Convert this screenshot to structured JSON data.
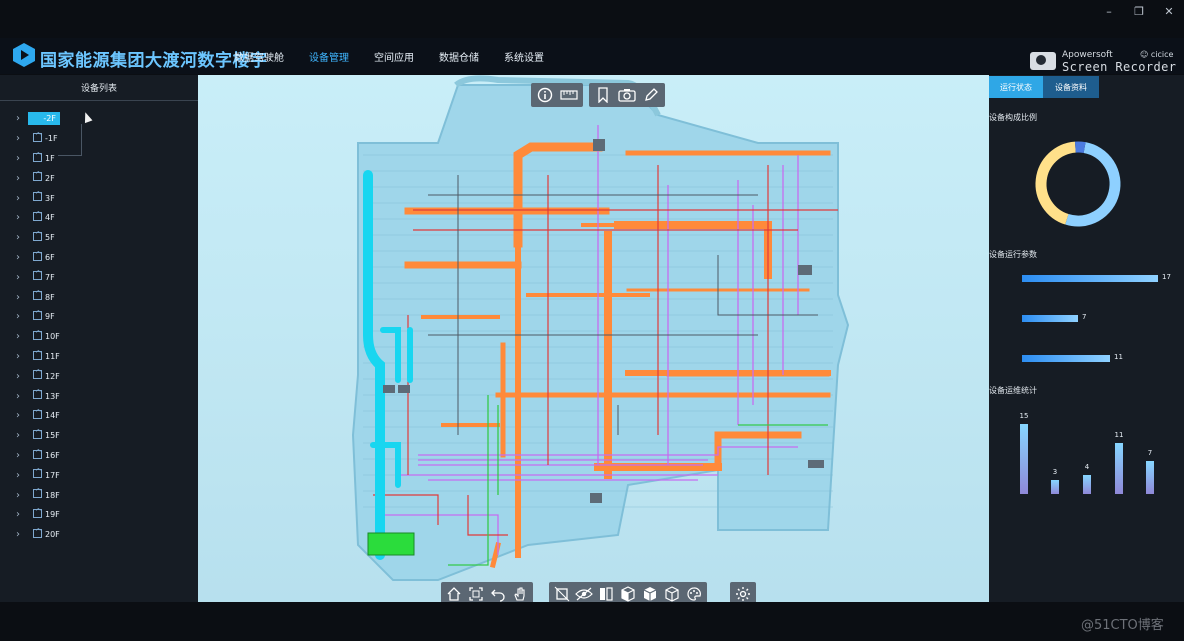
{
  "window": {
    "controls": [
      "–",
      "❐",
      "✕"
    ]
  },
  "header": {
    "title": "国家能源集团大渡河数字楼宇",
    "nav": [
      {
        "label": "数据驾驶舱",
        "active": false
      },
      {
        "label": "设备管理",
        "active": true
      },
      {
        "label": "空间应用",
        "active": false
      },
      {
        "label": "数据仓储",
        "active": false
      },
      {
        "label": "系统设置",
        "active": false
      }
    ],
    "recorder_brand": "Apowersoft",
    "recorder_name": "Screen Recorder",
    "user": "cicice"
  },
  "left_panel": {
    "title": "设备列表",
    "floors": [
      "-2F",
      "-1F",
      "1F",
      "2F",
      "3F",
      "4F",
      "5F",
      "6F",
      "7F",
      "8F",
      "9F",
      "10F",
      "11F",
      "12F",
      "13F",
      "14F",
      "15F",
      "16F",
      "17F",
      "18F",
      "19F",
      "20F"
    ],
    "selected": "-2F"
  },
  "viewport": {
    "top_tools_a": [
      "info-icon",
      "ruler-icon"
    ],
    "top_tools_b": [
      "bookmark-icon",
      "camera-icon",
      "pencil-icon"
    ],
    "bottom_tools_a": [
      "home-icon",
      "fit-icon",
      "undo-icon",
      "hand-icon"
    ],
    "bottom_tools_b": [
      "section-icon",
      "hide-icon",
      "split-icon",
      "cube-front-icon",
      "cube-solid-icon",
      "cube-wire-icon",
      "palette-icon"
    ],
    "bottom_tools_c": [
      "settings-icon"
    ]
  },
  "right_panel": {
    "tabs": [
      {
        "label": "运行状态",
        "active": true
      },
      {
        "label": "设备资料",
        "active": false
      }
    ],
    "composition_title": "设备构成比例",
    "params_title": "设备运行参数",
    "maintenance_title": "设备运维统计",
    "colors": {
      "donut_a": "#8ed0ff",
      "donut_b": "#ffe08a",
      "donut_c": "#4c7be0"
    }
  },
  "chart_data": [
    {
      "type": "pie",
      "title": "设备构成比例",
      "values": [
        52,
        44,
        4
      ]
    },
    {
      "type": "bar",
      "title": "设备运行参数",
      "orientation": "horizontal",
      "values": [
        17,
        7,
        11
      ],
      "value_labels": [
        "17",
        "7",
        "11"
      ]
    },
    {
      "type": "bar",
      "title": "设备运维统计",
      "values": [
        15,
        3,
        4,
        11,
        7
      ],
      "value_labels": [
        "15",
        "3",
        "4",
        "11",
        "7"
      ]
    }
  ],
  "watermark": "@51CTO博客"
}
